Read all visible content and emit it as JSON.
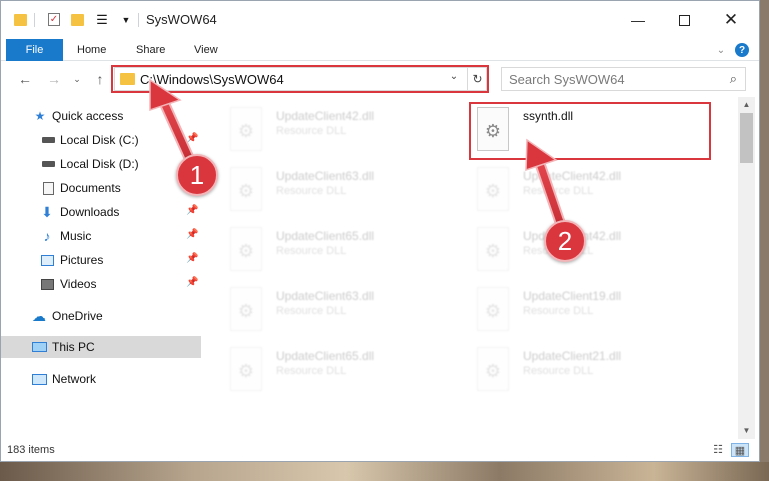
{
  "window": {
    "title": "SysWOW64"
  },
  "ribbon": {
    "tabs": [
      "File",
      "Home",
      "Share",
      "View"
    ],
    "help": "?"
  },
  "address": {
    "path": "C:\\Windows\\SysWOW64"
  },
  "search": {
    "placeholder": "Search SysWOW64"
  },
  "nav_pane": {
    "items": [
      {
        "label": "Quick access",
        "icon": "star-icon"
      },
      {
        "label": "Local Disk (C:)",
        "icon": "drive-icon"
      },
      {
        "label": "Local Disk (D:)",
        "icon": "drive-icon"
      },
      {
        "label": "Documents",
        "icon": "documents-icon"
      },
      {
        "label": "Downloads",
        "icon": "download-icon"
      },
      {
        "label": "Music",
        "icon": "music-icon"
      },
      {
        "label": "Pictures",
        "icon": "pictures-icon"
      },
      {
        "label": "Videos",
        "icon": "videos-icon"
      },
      {
        "label": "OneDrive",
        "icon": "cloud-icon"
      },
      {
        "label": "This PC",
        "icon": "computer-icon",
        "selected": true
      },
      {
        "label": "Network",
        "icon": "network-icon"
      }
    ]
  },
  "files": {
    "col1": [
      {
        "name": "UpdateClient42.dll",
        "type": "Resource DLL"
      },
      {
        "name": "UpdateClient63.dll",
        "type": "Resource DLL"
      },
      {
        "name": "UpdateClient65.dll",
        "type": "Resource DLL"
      },
      {
        "name": "UpdateClient63.dll",
        "type": "Resource DLL"
      },
      {
        "name": "UpdateClient65.dll",
        "type": "Resource DLL"
      }
    ],
    "highlighted": {
      "name": "ssynth.dll"
    },
    "col2": [
      {
        "name": "UpdateClient42.dll",
        "type": "Resource DLL"
      },
      {
        "name": "UpdateClient42.dll",
        "type": "Resource DLL"
      },
      {
        "name": "UpdateClient19.dll",
        "type": "Resource DLL"
      },
      {
        "name": "UpdateClient21.dll",
        "type": "Resource DLL"
      }
    ]
  },
  "status": {
    "item_count": "183 items"
  },
  "annotations": {
    "badge1": "1",
    "badge2": "2"
  },
  "colors": {
    "accent": "#1979ca",
    "highlight_red": "#d9363e",
    "selected_bg": "#d9d9d9"
  }
}
